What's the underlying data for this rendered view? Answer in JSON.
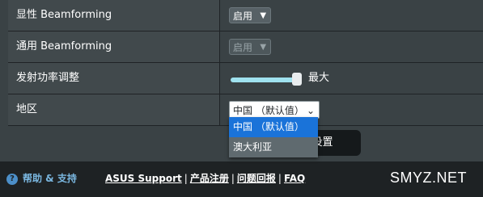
{
  "rows": [
    {
      "label": "显性 Beamforming",
      "control": "select",
      "value": "启用"
    },
    {
      "label": "通用 Beamforming",
      "control": "select",
      "value": "启用",
      "disabled": true
    },
    {
      "label": "发射功率调整",
      "control": "slider",
      "value_text": "最大",
      "level": 1.0
    },
    {
      "label": "地区",
      "control": "select",
      "value": "中国 （默认值）"
    }
  ],
  "region_dropdown": {
    "options": [
      "中国 （默认值）",
      "澳大利亚"
    ],
    "selected_index": 0
  },
  "apply_button_text": "面设置",
  "footer": {
    "help_icon": "question-circle-icon",
    "help_label": "帮助 & 支持",
    "links": [
      "ASUS Support",
      "产品注册",
      "问题回报",
      "FAQ"
    ],
    "separator": "|"
  },
  "watermark": "SMYZ.NET",
  "colors": {
    "selected_option": "#1a73d9",
    "help_text": "#7ab7e0"
  }
}
